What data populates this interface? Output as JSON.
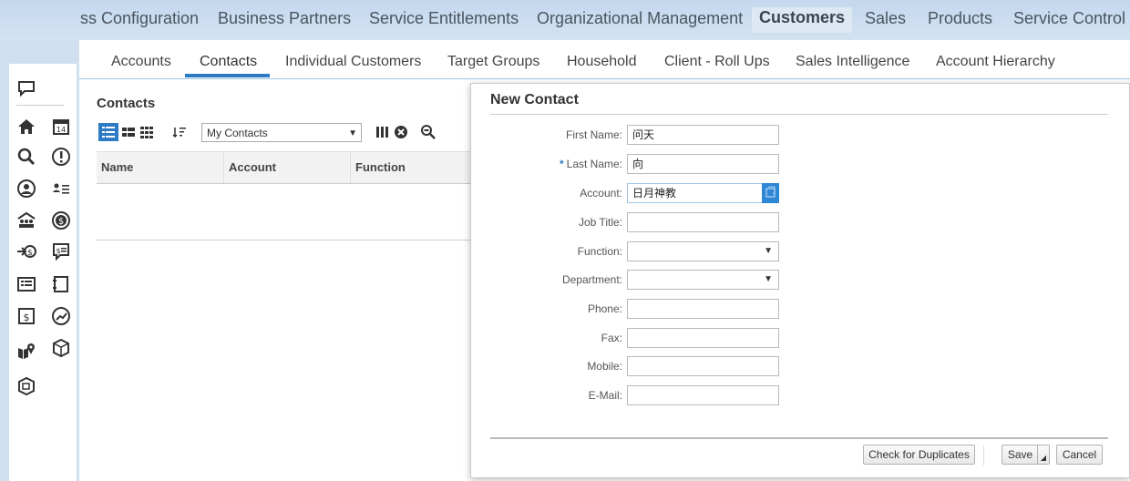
{
  "top_nav": {
    "items": [
      {
        "label": "ss Configuration"
      },
      {
        "label": "Business Partners"
      },
      {
        "label": "Service Entitlements"
      },
      {
        "label": "Organizational Management"
      },
      {
        "label": "Customers",
        "active": true
      },
      {
        "label": "Sales"
      },
      {
        "label": "Products"
      },
      {
        "label": "Service Control C"
      }
    ]
  },
  "sub_tabs": {
    "items": [
      {
        "label": "Accounts"
      },
      {
        "label": "Contacts",
        "active": true
      },
      {
        "label": "Individual Customers"
      },
      {
        "label": "Target Groups"
      },
      {
        "label": "Household"
      },
      {
        "label": "Client - Roll Ups"
      },
      {
        "label": "Sales Intelligence"
      },
      {
        "label": "Account Hierarchy"
      }
    ]
  },
  "contacts": {
    "title": "Contacts",
    "view_select": "My Contacts",
    "columns": [
      "Name",
      "Account",
      "Function"
    ]
  },
  "dialog": {
    "title": "New Contact",
    "fields": {
      "first_name": {
        "label": "First Name:",
        "value": "问天"
      },
      "last_name": {
        "label": "Last Name:",
        "value": "向",
        "required_mark": "*"
      },
      "account": {
        "label": "Account:",
        "value": "日月神教"
      },
      "job_title": {
        "label": "Job Title:",
        "value": ""
      },
      "function": {
        "label": "Function:",
        "value": ""
      },
      "department": {
        "label": "Department:",
        "value": ""
      },
      "phone": {
        "label": "Phone:",
        "value": ""
      },
      "fax": {
        "label": "Fax:",
        "value": ""
      },
      "mobile": {
        "label": "Mobile:",
        "value": ""
      },
      "email": {
        "label": "E-Mail:",
        "value": ""
      }
    },
    "buttons": {
      "check_duplicates": "Check for Duplicates",
      "save": "Save",
      "cancel": "Cancel"
    }
  },
  "colors": {
    "accent": "#2d7bc4",
    "nav_bg": "#c9dcef",
    "lookup_button": "#2e86d6"
  }
}
